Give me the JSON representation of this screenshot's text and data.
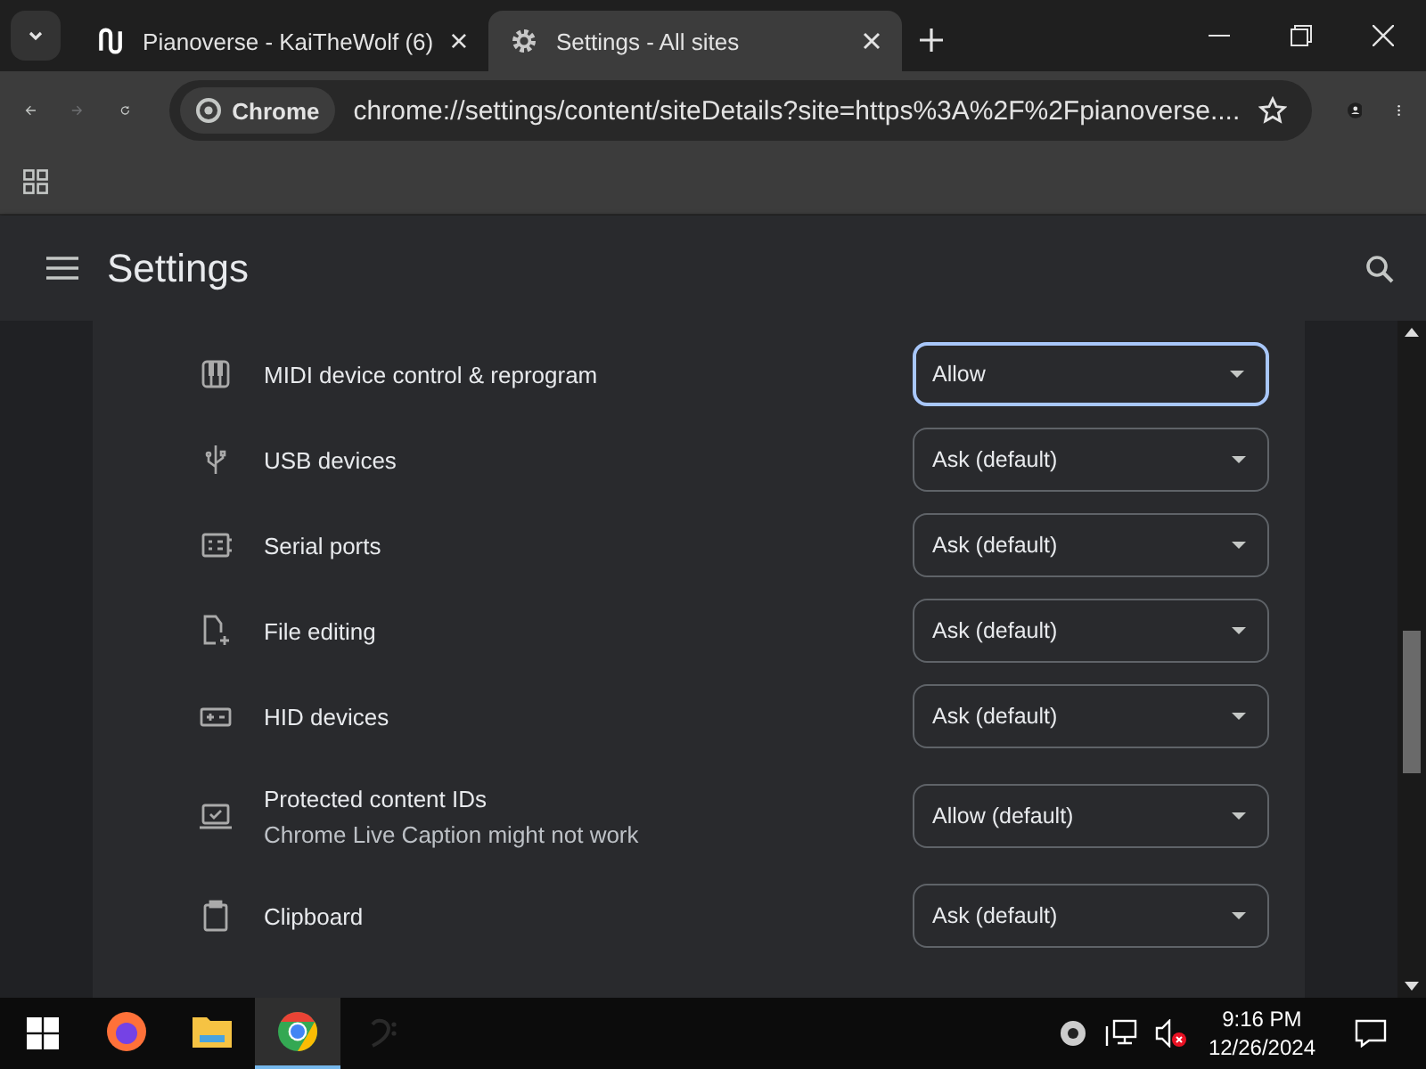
{
  "tabs": [
    {
      "title": "Pianoverse - KaiTheWolf (6)",
      "kind": "logo",
      "selected": false
    },
    {
      "title": "Settings - All sites",
      "kind": "gear",
      "selected": true
    }
  ],
  "toolbar": {
    "chip": "Chrome",
    "url": "chrome://settings/content/siteDetails?site=https%3A%2F%2Fpianoverse...."
  },
  "header": {
    "title": "Settings"
  },
  "permissions": [
    {
      "kind": "piano",
      "label": "MIDI device control & reprogram",
      "value": "Allow",
      "focused": true
    },
    {
      "kind": "usb",
      "label": "USB devices",
      "value": "Ask (default)",
      "focused": false
    },
    {
      "kind": "serial",
      "label": "Serial ports",
      "value": "Ask (default)",
      "focused": false
    },
    {
      "kind": "file",
      "label": "File editing",
      "value": "Ask (default)",
      "focused": false
    },
    {
      "kind": "hid",
      "label": "HID devices",
      "value": "Ask (default)",
      "focused": false
    },
    {
      "kind": "screen",
      "label": "Protected content IDs",
      "sublabel": "Chrome Live Caption might not work",
      "value": "Allow (default)",
      "focused": false
    },
    {
      "kind": "clipboard",
      "label": "Clipboard",
      "value": "Ask (default)",
      "focused": false
    }
  ],
  "taskbar": {
    "apps": [
      {
        "kind": "firefox",
        "selected": false
      },
      {
        "kind": "folder",
        "selected": false
      },
      {
        "kind": "chrome",
        "selected": true
      },
      {
        "kind": "clef",
        "selected": false
      }
    ],
    "time": "9:16 PM",
    "date": "12/26/2024"
  }
}
